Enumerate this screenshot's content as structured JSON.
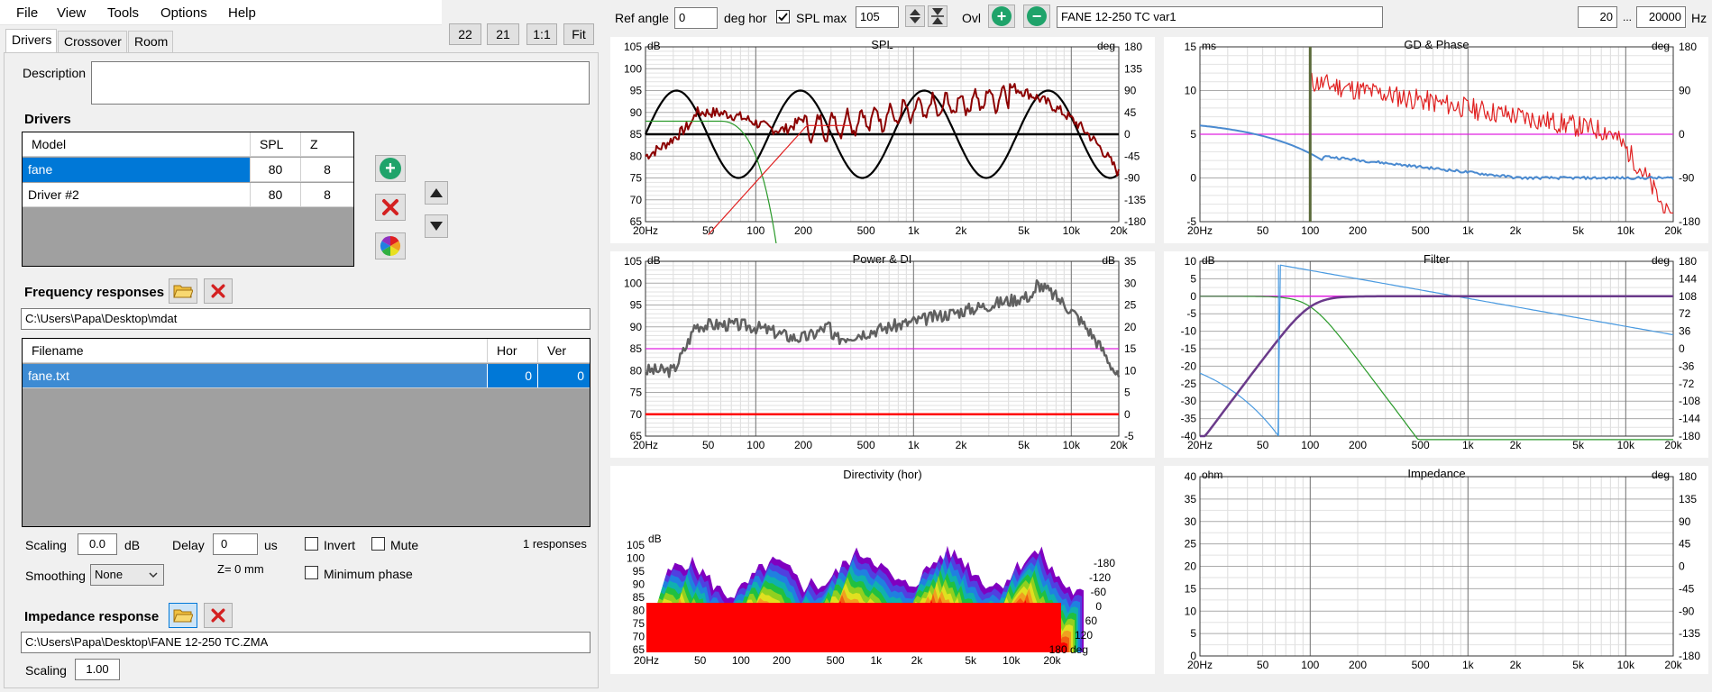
{
  "menu": {
    "file": "File",
    "view": "View",
    "tools": "Tools",
    "options": "Options",
    "help": "Help"
  },
  "toolbar": {
    "btn22": "22",
    "btn21": "21",
    "btn11": "1:1",
    "fit": "Fit",
    "ref_angle_label": "Ref angle",
    "ref_angle": "0",
    "deg_hor": "deg hor",
    "spl_max_label": "SPL max",
    "spl_max": "105",
    "ovl": "Ovl",
    "project": "FANE 12-250 TC var1",
    "fmin": "20",
    "ellipsis": "...",
    "fmax": "20000",
    "hz": "Hz"
  },
  "tabs": [
    "Drivers",
    "Crossover",
    "Room"
  ],
  "description_label": "Description",
  "drivers": {
    "title": "Drivers",
    "headers": [
      "Model",
      "SPL",
      "Z"
    ],
    "rows": [
      {
        "model": "fane",
        "spl": "80",
        "z": "8"
      },
      {
        "model": "Driver #2",
        "spl": "80",
        "z": "8"
      }
    ]
  },
  "freq": {
    "title": "Frequency responses",
    "path": "C:\\Users\\Papa\\Desktop\\mdat",
    "headers": [
      "Filename",
      "Hor",
      "Ver"
    ],
    "rows": [
      {
        "file": "fane.txt",
        "hor": "0",
        "ver": "0"
      }
    ]
  },
  "controls": {
    "scaling": "Scaling",
    "scaling_val": "0.0",
    "db": "dB",
    "delay": "Delay",
    "delay_val": "0",
    "us": "us",
    "invert": "Invert",
    "mute": "Mute",
    "responses": "1 responses",
    "smoothing": "Smoothing",
    "smoothing_val": "None",
    "z": "Z= 0 mm",
    "min_phase": "Minimum phase"
  },
  "impedance": {
    "title": "Impedance response",
    "path": "C:\\Users\\Papa\\Desktop\\FANE 12-250 TC.ZMA",
    "scaling": "Scaling",
    "scaling_val": "1.00"
  },
  "graphs": {
    "freq_ticks": [
      "20Hz",
      "50",
      "100",
      "200",
      "500",
      "1k",
      "2k",
      "5k",
      "10k",
      "20k"
    ],
    "spl": {
      "title": "SPL",
      "lu": "dB",
      "ru": "deg",
      "left": [
        "105",
        "100",
        "95",
        "90",
        "85",
        "80",
        "75",
        "70",
        "65"
      ],
      "right": [
        "180",
        "135",
        "90",
        "45",
        "0",
        "-45",
        "-90",
        "-135",
        "-180"
      ]
    },
    "gd": {
      "title": "GD & Phase",
      "lu": "ms",
      "ru": "deg",
      "left": [
        "15",
        "10",
        "5",
        "0",
        "-5"
      ],
      "right": [
        "180",
        "90",
        "0",
        "-90",
        "-180"
      ]
    },
    "power": {
      "title": "Power & DI",
      "lu": "dB",
      "ru": "dB",
      "left": [
        "105",
        "100",
        "95",
        "90",
        "85",
        "80",
        "75",
        "70",
        "65"
      ],
      "right": [
        "35",
        "30",
        "25",
        "20",
        "15",
        "10",
        "5",
        "0",
        "-5"
      ]
    },
    "filter": {
      "title": "Filter",
      "lu": "dB",
      "ru": "deg",
      "left": [
        "10",
        "5",
        "0",
        "-5",
        "-10",
        "-15",
        "-20",
        "-25",
        "-30",
        "-35",
        "-40"
      ],
      "right": [
        "180",
        "144",
        "108",
        "72",
        "36",
        "0",
        "-36",
        "-72",
        "-108",
        "-144",
        "-180"
      ]
    },
    "directivity": {
      "title": "Directivity (hor)",
      "lu": "dB",
      "left": [
        "105",
        "100",
        "95",
        "90",
        "85",
        "80",
        "75",
        "70",
        "65"
      ],
      "angles": [
        "-180",
        "-120",
        "-60",
        "0",
        "60",
        "120",
        "180 deg"
      ],
      "ticks": [
        "20Hz",
        "50",
        "100",
        "200",
        "500",
        "1k",
        "2k",
        "5k",
        "10k",
        "20k"
      ]
    },
    "imp": {
      "title": "Impedance",
      "lu": "ohm",
      "ru": "deg",
      "left": [
        "40",
        "35",
        "30",
        "25",
        "20",
        "15",
        "10",
        "5",
        "0"
      ],
      "right": [
        "180",
        "135",
        "90",
        "45",
        "0",
        "-45",
        "-90",
        "-135",
        "-180"
      ]
    }
  },
  "colors": {
    "accent": "#0078d7",
    "grid": "#d8d8d8",
    "add": "#1fa36a",
    "remove": "#d42020"
  }
}
